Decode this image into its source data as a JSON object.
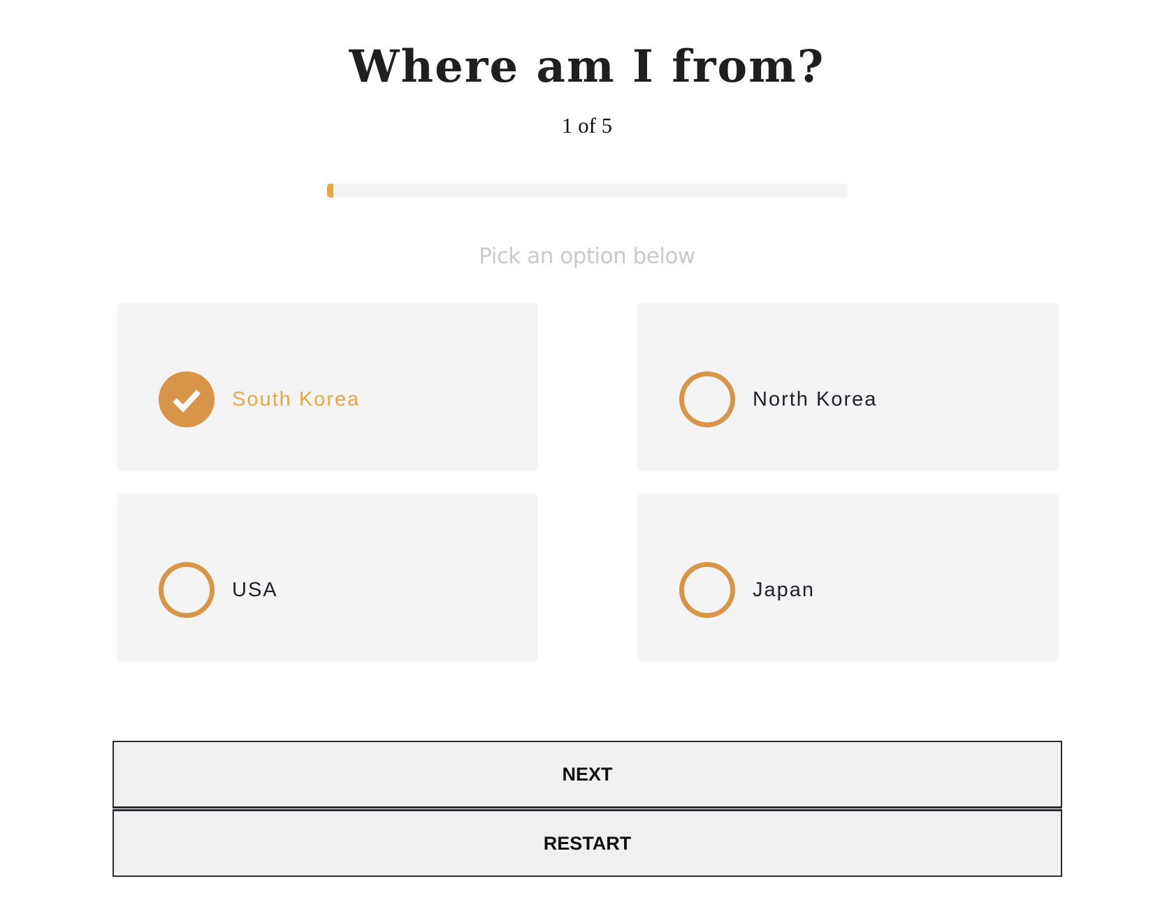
{
  "quiz": {
    "title": "Where am I from?",
    "counter": "1 of 5",
    "progress": {
      "current": 1,
      "total": 5,
      "fill_fraction": 0.012,
      "accent_color": "#eba641"
    },
    "prompt": "Pick an option below",
    "options": [
      {
        "label": "South Korea",
        "selected": true,
        "icon": "checkmark-circle-icon"
      },
      {
        "label": "North Korea",
        "selected": false,
        "icon": "radio-circle-icon"
      },
      {
        "label": "USA",
        "selected": false,
        "icon": "radio-circle-icon"
      },
      {
        "label": "Japan",
        "selected": false,
        "icon": "radio-circle-icon"
      }
    ],
    "colors": {
      "selected_text": "#eba641",
      "radio": "#d99547",
      "card_background": "#f4f4f4"
    }
  },
  "buttons": {
    "next_label": "NEXT",
    "restart_label": "RESTART"
  }
}
